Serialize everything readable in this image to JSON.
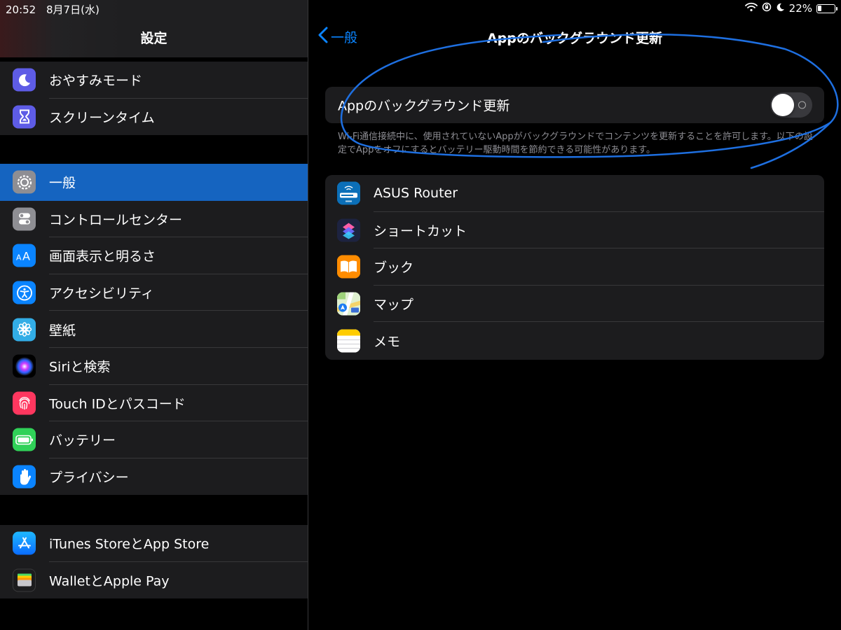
{
  "status_bar": {
    "time": "20:52",
    "date": "8月7日(水)",
    "battery_percent": "22%"
  },
  "sidebar": {
    "title": "設定",
    "groups": [
      {
        "items": [
          {
            "label": "おやすみモード",
            "icon": "moon-icon",
            "color": "#5e5ce6"
          },
          {
            "label": "スクリーンタイム",
            "icon": "hourglass-icon",
            "color": "#5e5ce6"
          }
        ]
      },
      {
        "items": [
          {
            "label": "一般",
            "icon": "gear-icon",
            "color": "#8e8e93",
            "selected": true
          },
          {
            "label": "コントロールセンター",
            "icon": "toggles-icon",
            "color": "#8e8e93"
          },
          {
            "label": "画面表示と明るさ",
            "icon": "text-size-icon",
            "color": "#0a84ff"
          },
          {
            "label": "アクセシビリティ",
            "icon": "accessibility-icon",
            "color": "#0a84ff"
          },
          {
            "label": "壁紙",
            "icon": "flower-icon",
            "color": "#32ade6"
          },
          {
            "label": "Siriと検索",
            "icon": "siri-icon",
            "color": "#000000"
          },
          {
            "label": "Touch IDとパスコード",
            "icon": "fingerprint-icon",
            "color": "#ff375f"
          },
          {
            "label": "バッテリー",
            "icon": "battery-icon",
            "color": "#30d158"
          },
          {
            "label": "プライバシー",
            "icon": "hand-icon",
            "color": "#0a84ff"
          }
        ]
      },
      {
        "items": [
          {
            "label": "iTunes StoreとApp Store",
            "icon": "app-store-icon",
            "color": "#0a84ff"
          },
          {
            "label": "WalletとApple Pay",
            "icon": "wallet-icon",
            "color": "#1c1c1e"
          }
        ]
      }
    ]
  },
  "detail": {
    "back_label": "一般",
    "title": "Appのバックグラウンド更新",
    "toggle": {
      "label": "Appのバックグラウンド更新",
      "on": false
    },
    "footnote": "Wi-Fi通信接続中に、使用されていないAppがバックグラウンドでコンテンツを更新することを許可します。以下の設定でAppをオフにするとバッテリー駆動時間を節約できる可能性があります。",
    "apps": [
      {
        "label": "ASUS Router",
        "icon": "asus-router-icon"
      },
      {
        "label": "ショートカット",
        "icon": "shortcuts-icon"
      },
      {
        "label": "ブック",
        "icon": "books-icon"
      },
      {
        "label": "マップ",
        "icon": "maps-icon"
      },
      {
        "label": "メモ",
        "icon": "notes-icon"
      }
    ]
  },
  "colors": {
    "accent": "#0a84ff",
    "selected_row": "#1564c0",
    "annotation": "#1e6fe0"
  }
}
